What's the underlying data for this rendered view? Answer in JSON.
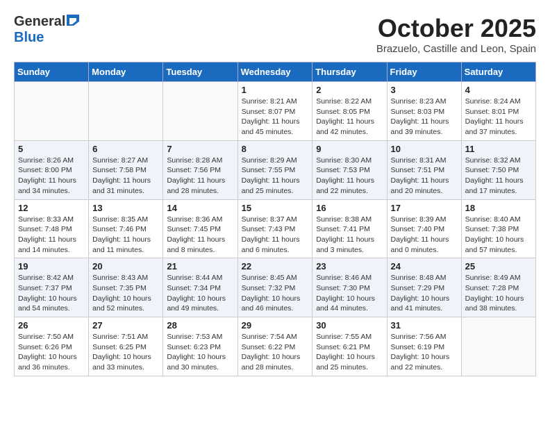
{
  "header": {
    "logo_general": "General",
    "logo_blue": "Blue",
    "month_title": "October 2025",
    "location": "Brazuelo, Castille and Leon, Spain"
  },
  "days_of_week": [
    "Sunday",
    "Monday",
    "Tuesday",
    "Wednesday",
    "Thursday",
    "Friday",
    "Saturday"
  ],
  "weeks": [
    {
      "days": [
        {
          "num": "",
          "info": ""
        },
        {
          "num": "",
          "info": ""
        },
        {
          "num": "",
          "info": ""
        },
        {
          "num": "1",
          "info": "Sunrise: 8:21 AM\nSunset: 8:07 PM\nDaylight: 11 hours and 45 minutes."
        },
        {
          "num": "2",
          "info": "Sunrise: 8:22 AM\nSunset: 8:05 PM\nDaylight: 11 hours and 42 minutes."
        },
        {
          "num": "3",
          "info": "Sunrise: 8:23 AM\nSunset: 8:03 PM\nDaylight: 11 hours and 39 minutes."
        },
        {
          "num": "4",
          "info": "Sunrise: 8:24 AM\nSunset: 8:01 PM\nDaylight: 11 hours and 37 minutes."
        }
      ]
    },
    {
      "days": [
        {
          "num": "5",
          "info": "Sunrise: 8:26 AM\nSunset: 8:00 PM\nDaylight: 11 hours and 34 minutes."
        },
        {
          "num": "6",
          "info": "Sunrise: 8:27 AM\nSunset: 7:58 PM\nDaylight: 11 hours and 31 minutes."
        },
        {
          "num": "7",
          "info": "Sunrise: 8:28 AM\nSunset: 7:56 PM\nDaylight: 11 hours and 28 minutes."
        },
        {
          "num": "8",
          "info": "Sunrise: 8:29 AM\nSunset: 7:55 PM\nDaylight: 11 hours and 25 minutes."
        },
        {
          "num": "9",
          "info": "Sunrise: 8:30 AM\nSunset: 7:53 PM\nDaylight: 11 hours and 22 minutes."
        },
        {
          "num": "10",
          "info": "Sunrise: 8:31 AM\nSunset: 7:51 PM\nDaylight: 11 hours and 20 minutes."
        },
        {
          "num": "11",
          "info": "Sunrise: 8:32 AM\nSunset: 7:50 PM\nDaylight: 11 hours and 17 minutes."
        }
      ]
    },
    {
      "days": [
        {
          "num": "12",
          "info": "Sunrise: 8:33 AM\nSunset: 7:48 PM\nDaylight: 11 hours and 14 minutes."
        },
        {
          "num": "13",
          "info": "Sunrise: 8:35 AM\nSunset: 7:46 PM\nDaylight: 11 hours and 11 minutes."
        },
        {
          "num": "14",
          "info": "Sunrise: 8:36 AM\nSunset: 7:45 PM\nDaylight: 11 hours and 8 minutes."
        },
        {
          "num": "15",
          "info": "Sunrise: 8:37 AM\nSunset: 7:43 PM\nDaylight: 11 hours and 6 minutes."
        },
        {
          "num": "16",
          "info": "Sunrise: 8:38 AM\nSunset: 7:41 PM\nDaylight: 11 hours and 3 minutes."
        },
        {
          "num": "17",
          "info": "Sunrise: 8:39 AM\nSunset: 7:40 PM\nDaylight: 11 hours and 0 minutes."
        },
        {
          "num": "18",
          "info": "Sunrise: 8:40 AM\nSunset: 7:38 PM\nDaylight: 10 hours and 57 minutes."
        }
      ]
    },
    {
      "days": [
        {
          "num": "19",
          "info": "Sunrise: 8:42 AM\nSunset: 7:37 PM\nDaylight: 10 hours and 54 minutes."
        },
        {
          "num": "20",
          "info": "Sunrise: 8:43 AM\nSunset: 7:35 PM\nDaylight: 10 hours and 52 minutes."
        },
        {
          "num": "21",
          "info": "Sunrise: 8:44 AM\nSunset: 7:34 PM\nDaylight: 10 hours and 49 minutes."
        },
        {
          "num": "22",
          "info": "Sunrise: 8:45 AM\nSunset: 7:32 PM\nDaylight: 10 hours and 46 minutes."
        },
        {
          "num": "23",
          "info": "Sunrise: 8:46 AM\nSunset: 7:30 PM\nDaylight: 10 hours and 44 minutes."
        },
        {
          "num": "24",
          "info": "Sunrise: 8:48 AM\nSunset: 7:29 PM\nDaylight: 10 hours and 41 minutes."
        },
        {
          "num": "25",
          "info": "Sunrise: 8:49 AM\nSunset: 7:28 PM\nDaylight: 10 hours and 38 minutes."
        }
      ]
    },
    {
      "days": [
        {
          "num": "26",
          "info": "Sunrise: 7:50 AM\nSunset: 6:26 PM\nDaylight: 10 hours and 36 minutes."
        },
        {
          "num": "27",
          "info": "Sunrise: 7:51 AM\nSunset: 6:25 PM\nDaylight: 10 hours and 33 minutes."
        },
        {
          "num": "28",
          "info": "Sunrise: 7:53 AM\nSunset: 6:23 PM\nDaylight: 10 hours and 30 minutes."
        },
        {
          "num": "29",
          "info": "Sunrise: 7:54 AM\nSunset: 6:22 PM\nDaylight: 10 hours and 28 minutes."
        },
        {
          "num": "30",
          "info": "Sunrise: 7:55 AM\nSunset: 6:21 PM\nDaylight: 10 hours and 25 minutes."
        },
        {
          "num": "31",
          "info": "Sunrise: 7:56 AM\nSunset: 6:19 PM\nDaylight: 10 hours and 22 minutes."
        },
        {
          "num": "",
          "info": ""
        }
      ]
    }
  ]
}
